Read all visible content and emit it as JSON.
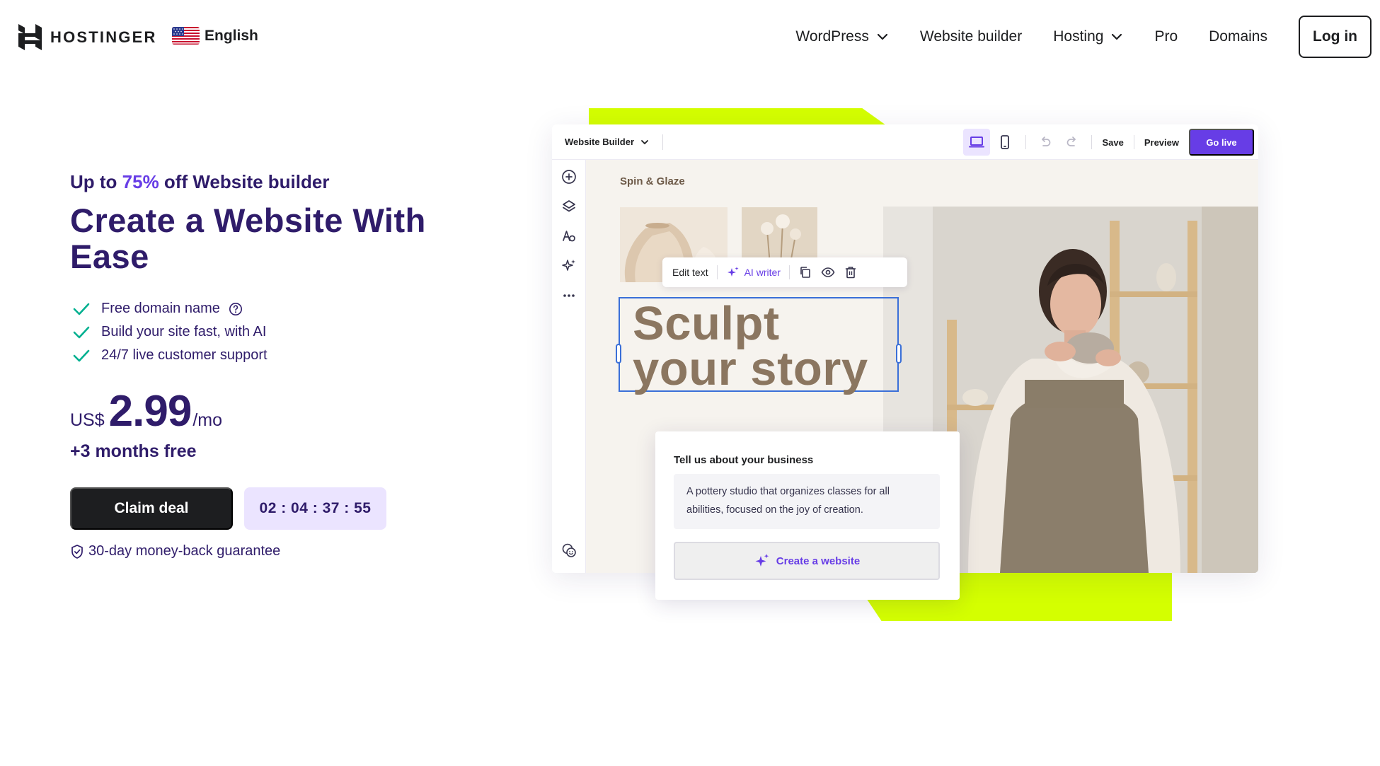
{
  "header": {
    "brand": "HOSTINGER",
    "language": "English",
    "nav": [
      {
        "label": "WordPress",
        "dropdown": true
      },
      {
        "label": "Website builder",
        "dropdown": false
      },
      {
        "label": "Hosting",
        "dropdown": true
      },
      {
        "label": "Pro",
        "dropdown": false
      },
      {
        "label": "Domains",
        "dropdown": false
      }
    ],
    "login_label": "Log in"
  },
  "hero": {
    "kicker_prefix": "Up to ",
    "kicker_accent": "75%",
    "kicker_suffix": " off Website builder",
    "title": "Create a Website With Ease",
    "features": [
      "Free domain name",
      "Build your site fast, with AI",
      "24/7 live customer support"
    ],
    "price_currency": "US$",
    "price_amount": "2.99",
    "price_period": "/mo",
    "bonus": "+3 months free",
    "cta_label": "Claim deal",
    "countdown": "02 : 04 : 37 : 55",
    "guarantee": "30-day money-back guarantee"
  },
  "editor": {
    "dropdown_label": "Website Builder",
    "save_label": "Save",
    "preview_label": "Preview",
    "golive_label": "Go live",
    "site_name": "Spin & Glaze",
    "toolbar": {
      "edit_text": "Edit text",
      "ai_writer": "AI writer"
    },
    "headline_line1": "Sculpt",
    "headline_line2": "your story",
    "prompt_card": {
      "title": "Tell us about your business",
      "text": "A pottery studio that organizes classes for all abilities, focused on the joy of creation.",
      "button_label": "Create a website"
    }
  },
  "colors": {
    "brand_dark": "#2f1c6a",
    "accent_purple": "#673de6",
    "lime": "#d4ff00",
    "button_dark": "#1d1e20",
    "timer_bg": "#ebe4ff",
    "check_green": "#00b090"
  },
  "icons": [
    "hostinger-logo-icon",
    "us-flag-icon",
    "chevron-down-icon",
    "check-icon",
    "help-circle-icon",
    "shield-icon",
    "desktop-icon",
    "mobile-icon",
    "undo-icon",
    "redo-icon",
    "add-circle-icon",
    "layers-icon",
    "text-style-icon",
    "sparkles-icon",
    "more-dots-icon",
    "help-chat-icon",
    "copy-icon",
    "eye-icon",
    "trash-icon"
  ]
}
